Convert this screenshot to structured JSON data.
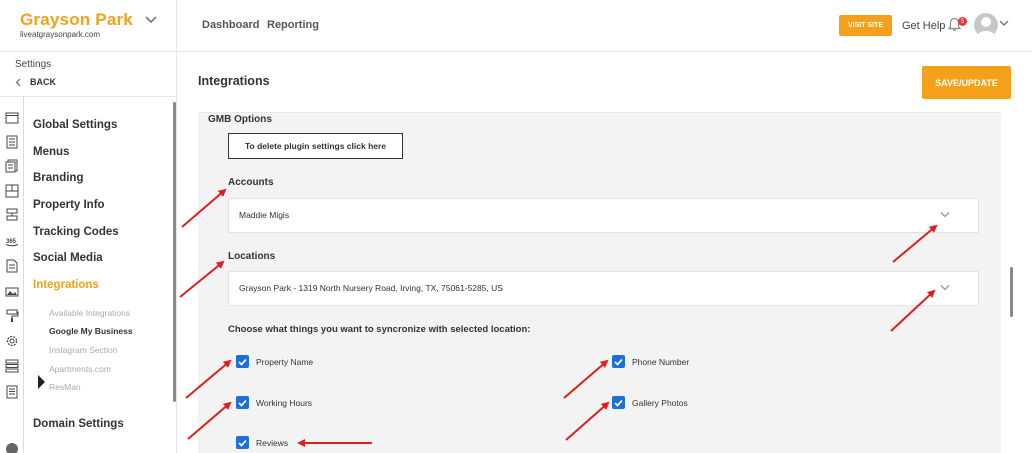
{
  "brand": {
    "name": "Grayson Park",
    "url": "liveatgraysonpark.com"
  },
  "topnav": {
    "items": [
      {
        "label": "Dashboard"
      },
      {
        "label": "Reporting"
      }
    ],
    "visit_site": "VISIT SITE",
    "get_help": "Get Help",
    "notification_count": "5"
  },
  "sidebar": {
    "settings_label": "Settings",
    "back_label": "BACK",
    "menu": [
      {
        "label": "Global Settings"
      },
      {
        "label": "Menus"
      },
      {
        "label": "Branding"
      },
      {
        "label": "Property Info"
      },
      {
        "label": "Tracking Codes"
      },
      {
        "label": "Social Media"
      },
      {
        "label": "Integrations",
        "active": true
      },
      {
        "label": "Domain Settings"
      }
    ],
    "submenu": [
      {
        "label": "Available Integrations"
      },
      {
        "label": "Google My Business",
        "active": true
      },
      {
        "label": "Instagram Section"
      },
      {
        "label": "Apartments.com"
      },
      {
        "label": "ResMan"
      }
    ],
    "rail_icons": [
      "browser-icon",
      "document-icon",
      "pages-icon",
      "layout-icon",
      "components-icon",
      "seo-icon",
      "file-icon",
      "image-icon",
      "brush-icon",
      "gear-icon",
      "stack-icon",
      "doc-lines-icon"
    ]
  },
  "main": {
    "title": "Integrations",
    "save_label": "SAVE/UPDATE",
    "gmb_options_label": "GMB Options",
    "delete_settings_label": "To delete plugin settings click here",
    "accounts_label": "Accounts",
    "account_value": "Maddie Migis",
    "locations_label": "Locations",
    "location_value": "Grayson Park - 1319 North Nursery Road, Irving, TX, 75061-5285, US",
    "sync_label": "Choose what things you want to syncronize with selected location:",
    "sync_options": [
      {
        "label": "Property Name",
        "checked": true
      },
      {
        "label": "Phone Number",
        "checked": true
      },
      {
        "label": "Working Hours",
        "checked": true
      },
      {
        "label": "Gallery Photos",
        "checked": true
      },
      {
        "label": "Reviews",
        "checked": true
      }
    ]
  },
  "colors": {
    "accent": "#f5a01a",
    "checkbox": "#1e6fd9",
    "annotation_arrow": "#e01e1e"
  }
}
